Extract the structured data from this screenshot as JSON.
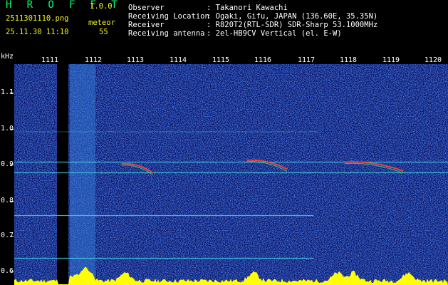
{
  "app": {
    "title": "H R O F F T",
    "version": "1.0.0"
  },
  "capture": {
    "file_name": "2511301110.png",
    "date_time": "25.11.30 11:10",
    "mode": "meteor",
    "count": "55"
  },
  "station": {
    "labels_text": "Observer\nReceiving Location\nReceiver\nReceiving antenna",
    "values_text": ": Takanori Kawachi\n: Ogaki, Gifu, JAPAN (136.60E, 35.35N)\n: R820T2(RTL-SDR) SDR-Sharp 53.1000MHz\n: 2el-HB9CV Vertical (el. E-W)"
  },
  "colors": {
    "header_yellow": "#f2f21e",
    "title_green": "#00ff6a",
    "background": "#000000",
    "noise_blue": "#1020a0",
    "trace_cyan": "#40d0e0",
    "echo_red": "#ff4040",
    "intensity_yellow": "#ffff00"
  },
  "spectrogram": {
    "y_unit": "kHz",
    "y_ticks": [
      "1.1",
      "1.0",
      "0.9",
      "0.8",
      "0.7",
      "0.6"
    ],
    "x_ticks": [
      "1111",
      "1112",
      "1113",
      "1114",
      "1115",
      "1116",
      "1117",
      "1118",
      "1119",
      "1120"
    ],
    "freq_range_khz": [
      0.58,
      1.2
    ],
    "time_range_min": [
      1110.5,
      1120.2
    ],
    "carriers_khz": [
      0.925,
      0.895,
      0.775,
      0.655,
      1.01
    ],
    "meteor_echoes": [
      {
        "time_start": 1112.9,
        "time_end": 1113.6,
        "freq_khz": 0.92
      },
      {
        "time_start": 1115.7,
        "time_end": 1116.6,
        "freq_khz": 0.93
      },
      {
        "time_start": 1117.9,
        "time_end": 1119.2,
        "freq_khz": 0.925
      }
    ]
  }
}
